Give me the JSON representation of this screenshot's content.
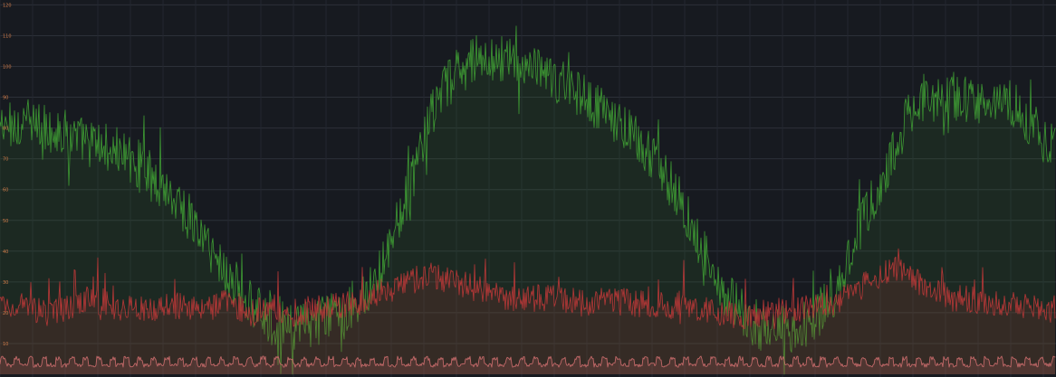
{
  "chart_data": {
    "type": "area",
    "title": "",
    "xlabel": "",
    "ylabel": "",
    "grid": true,
    "legend": "none",
    "y_ticks": [
      "10",
      "20",
      "30",
      "40",
      "50",
      "60",
      "70",
      "80",
      "90",
      "100",
      "110",
      "120"
    ],
    "ylim": [
      0,
      121
    ],
    "x": [
      0,
      25,
      50,
      75,
      100,
      125,
      150,
      175,
      200,
      225,
      250,
      275,
      300,
      325,
      350,
      375,
      400,
      425,
      450,
      475,
      500,
      525,
      550,
      575,
      600,
      625,
      650,
      675,
      700,
      725,
      750,
      775,
      800,
      825,
      850,
      875,
      900,
      925,
      950,
      975,
      1000,
      1025,
      1050,
      1075,
      1100,
      1125,
      1150,
      1166
    ],
    "series": [
      {
        "color": "#3e9b34",
        "values": [
          80,
          82,
          80,
          78,
          75,
          73,
          69,
          63,
          55,
          44,
          33,
          23,
          17,
          15,
          17,
          20,
          25,
          37,
          58,
          83,
          97,
          102,
          103,
          101,
          97,
          94,
          89,
          83,
          78,
          70,
          57,
          42,
          27,
          18,
          14,
          15,
          17,
          30,
          48,
          62,
          82,
          89,
          91,
          88,
          90,
          86,
          78,
          72
        ]
      },
      {
        "color": "#b93838",
        "values": [
          23,
          22,
          20,
          21,
          25,
          22,
          21,
          22,
          22,
          21,
          23,
          20,
          21,
          20,
          21,
          22,
          24,
          27,
          30,
          32,
          30,
          28,
          26,
          24,
          25,
          24,
          23,
          24,
          23,
          22,
          23,
          21,
          20,
          19,
          20,
          21,
          22,
          24,
          28,
          33,
          34,
          28,
          25,
          24,
          23,
          23,
          22,
          21
        ]
      },
      {
        "color": "#c86b6b",
        "values": [
          3,
          3,
          3,
          3,
          3,
          3,
          3,
          3,
          3,
          3,
          3,
          3,
          3,
          3,
          3,
          3,
          3,
          3,
          3,
          3,
          3,
          3,
          3,
          3,
          3,
          3,
          3,
          3,
          3,
          3,
          3,
          3,
          3,
          3,
          3,
          3,
          3,
          3,
          3,
          3,
          3,
          3,
          3,
          3,
          3,
          3,
          3,
          3
        ]
      }
    ]
  }
}
